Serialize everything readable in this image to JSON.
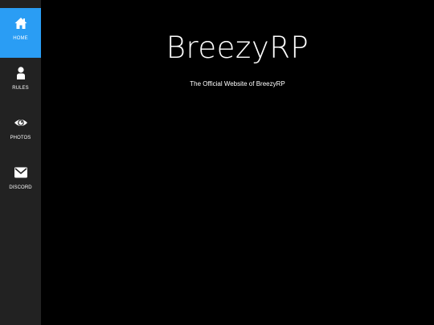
{
  "sidebar": {
    "items": [
      {
        "label": "HOME",
        "icon": "home-icon",
        "active": true
      },
      {
        "label": "RULES",
        "icon": "user-icon",
        "active": false
      },
      {
        "label": "PHOTOS",
        "icon": "eye-icon",
        "active": false
      },
      {
        "label": "DISCORD",
        "icon": "envelope-icon",
        "active": false
      }
    ]
  },
  "main": {
    "title": "BreezyRP",
    "subtitle": "The Official Website of BreezyRP"
  },
  "colors": {
    "background": "#000000",
    "sidebar": "#222222",
    "accent": "#2a9df4",
    "text": "#ffffff"
  }
}
